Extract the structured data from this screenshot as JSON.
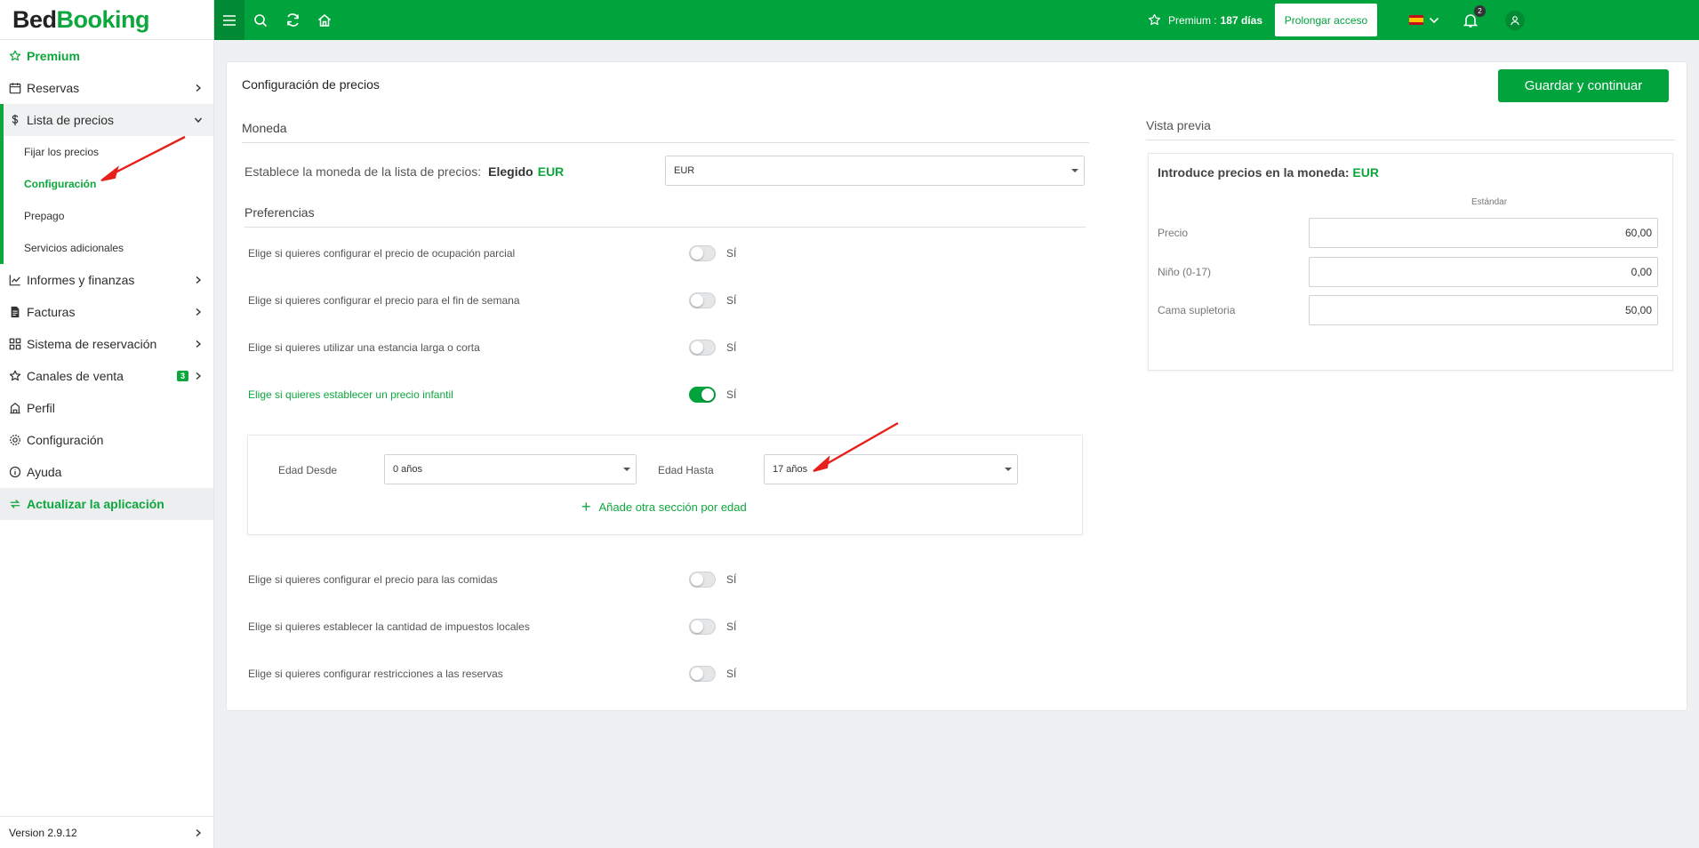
{
  "brand": {
    "part1": "Bed",
    "part2": "Booking"
  },
  "sidebar": {
    "premium": "Premium",
    "reservas": "Reservas",
    "lista_precios": "Lista de precios",
    "sub": [
      "Fijar los precios",
      "Configuración",
      "Prepago",
      "Servicios adicionales"
    ],
    "informes": "Informes y finanzas",
    "facturas": "Facturas",
    "sistema": "Sistema de reservación",
    "canales": "Canales de venta",
    "canales_badge": "3",
    "perfil": "Perfil",
    "configuracion": "Configuración",
    "ayuda": "Ayuda",
    "actualizar": "Actualizar la aplicación",
    "version": "Version 2.9.12"
  },
  "topbar": {
    "premium_label": "Premium :",
    "premium_days": "187 días",
    "extend_button": "Prolongar acceso",
    "notifications_count": "2"
  },
  "main": {
    "title": "Configuración de precios",
    "save_button": "Guardar y continuar",
    "currency_section": "Moneda",
    "currency_text": "Establece la moneda de la lista de precios:",
    "currency_chosen_label": "Elegido",
    "currency_chosen_value": "EUR",
    "currency_select_value": "EUR",
    "preferences_section": "Preferencias",
    "prefs": [
      {
        "label": "Elige si quieres configurar el precio de ocupación parcial",
        "toggle": "SÍ",
        "on": false
      },
      {
        "label": "Elige si quieres configurar el precio para el fin de semana",
        "toggle": "SÍ",
        "on": false
      },
      {
        "label": "Elige si quieres utilizar una estancia larga o corta",
        "toggle": "SÍ",
        "on": false
      },
      {
        "label": "Elige si quieres establecer un precio infantil",
        "toggle": "SÍ",
        "on": true
      },
      {
        "label": "Elige si quieres configurar el precio para las comidas",
        "toggle": "SÍ",
        "on": false
      },
      {
        "label": "Elige si quieres establecer la cantidad de impuestos locales",
        "toggle": "SÍ",
        "on": false
      },
      {
        "label": "Elige si quieres configurar restricciones a las reservas",
        "toggle": "SÍ",
        "on": false
      }
    ],
    "age": {
      "from_label": "Edad Desde",
      "from_value": "0 años",
      "to_label": "Edad Hasta",
      "to_value": "17 años",
      "add_section": "Añade otra sección por edad"
    }
  },
  "preview": {
    "heading": "Vista previa",
    "title_prefix": "Introduce precios en la moneda:",
    "title_currency": "EUR",
    "column": "Estándar",
    "rows": [
      {
        "label": "Precio",
        "value": "60,00"
      },
      {
        "label": "Niño (0-17)",
        "value": "0,00"
      },
      {
        "label": "Cama supletoria",
        "value": "50,00"
      }
    ]
  },
  "colors": {
    "accent": "#00a33c",
    "annotation": "#e8201c"
  }
}
